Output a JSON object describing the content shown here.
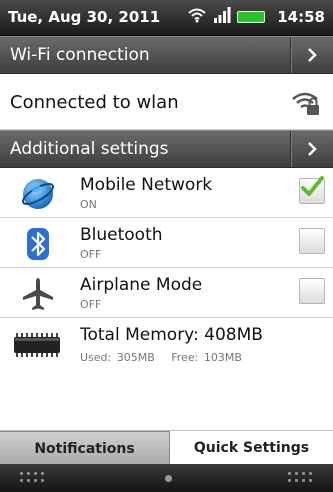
{
  "status_bar": {
    "date": "Tue, Aug 30, 2011",
    "time": "14:58",
    "icons": [
      "wifi-icon",
      "signal-icon",
      "battery-icon"
    ]
  },
  "wifi": {
    "header_label": "Wi-Fi connection",
    "connection_label": "Connected to wlan",
    "secured_icon": "secured-wifi-icon"
  },
  "additional": {
    "header_label": "Additional settings"
  },
  "items": [
    {
      "title": "Mobile Network",
      "status": "ON",
      "icon": "globe-icon",
      "checked": true
    },
    {
      "title": "Bluetooth",
      "status": "OFF",
      "icon": "bluetooth-icon",
      "checked": false
    },
    {
      "title": "Airplane Mode",
      "status": "OFF",
      "icon": "airplane-icon",
      "checked": false
    }
  ],
  "memory": {
    "title": "Total Memory: 408MB",
    "used": "Used: 305MB",
    "free": "Free: 103MB",
    "icon": "memory-chip-icon"
  },
  "tabs": [
    {
      "label": "Notifications",
      "selected": false
    },
    {
      "label": "Quick Settings",
      "selected": true
    }
  ],
  "colors": {
    "header_dark": "#4a4a4a",
    "check_green": "#5cbf2a",
    "globe_blue": "#1e88d8",
    "bluetooth_blue": "#2a6fd6"
  }
}
